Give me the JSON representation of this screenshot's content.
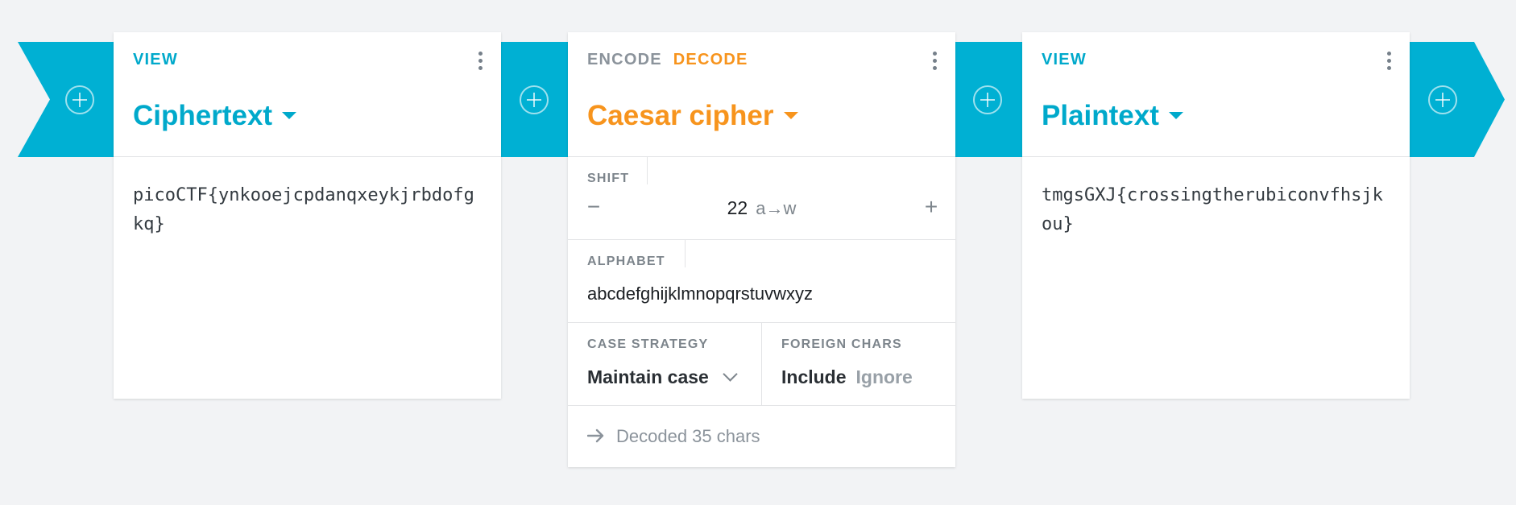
{
  "pipeline": {
    "cards": [
      {
        "tabs": [
          "VIEW"
        ],
        "title": "Ciphertext",
        "content": "picoCTF{ynkooejcpdanqxeykjrbdofgkq}"
      },
      {
        "tabs": [
          "ENCODE",
          "DECODE"
        ],
        "active_tab": "DECODE",
        "title": "Caesar cipher",
        "settings": {
          "shift": {
            "label": "SHIFT",
            "value": "22",
            "mapping": "a→w",
            "minus": "−",
            "plus": "+"
          },
          "alphabet": {
            "label": "ALPHABET",
            "value": "abcdefghijklmnopqrstuvwxyz"
          },
          "case_strategy": {
            "label": "CASE STRATEGY",
            "value": "Maintain case"
          },
          "foreign_chars": {
            "label": "FOREIGN CHARS",
            "options": [
              "Include",
              "Ignore"
            ],
            "selected": "Include"
          }
        },
        "status": "Decoded 35 chars"
      },
      {
        "tabs": [
          "VIEW"
        ],
        "title": "Plaintext",
        "content": "tmgsGXJ{crossingtherubiconvfhsjkou}"
      }
    ]
  },
  "colors": {
    "ribbon": "#00b0d3",
    "view_accent": "#00a9cb",
    "decode_accent": "#f7941d",
    "background": "#f2f3f5"
  },
  "icons": {
    "add_slot": "plus-circle-icon",
    "menu": "more-vertical-icon",
    "dropdown": "caret-down-icon",
    "status": "arrow-right-icon"
  }
}
